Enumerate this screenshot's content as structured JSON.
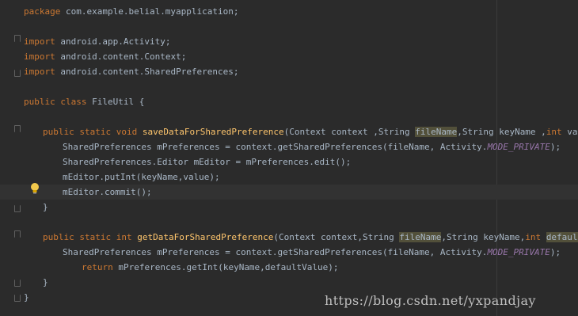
{
  "code": {
    "pkg_kw": "package",
    "pkg_name": " com.example.belial.myapplication;",
    "import_kw": "import",
    "import_1": " android.app.Activity;",
    "import_2": " android.content.Context;",
    "import_3": " android.content.SharedPreferences;",
    "class_kw": "public class",
    "class_name": " FileUtil {",
    "m1_kw": "public static void",
    "m1_name": "saveDataForSharedPreference",
    "m1_params_a": "(Context context ,String ",
    "m1_param_hl": "fileName",
    "m1_params_b": ",String keyName ,",
    "m1_int": "int",
    "m1_params_c": " value){",
    "m1_l1_a": "SharedPreferences mPreferences = context.getSharedPreferences(fileName, Activity.",
    "m1_l1_const": "MODE_PRIVATE",
    "m1_l1_b": ");",
    "m1_l2": "SharedPreferences.Editor mEditor = mPreferences.edit();",
    "m1_l3": "mEditor.putInt(keyName,value);",
    "m1_l4": "mEditor.commit();",
    "close_brace": "}",
    "m2_kw": "public static int",
    "m2_name": "getDataForSharedPreference",
    "m2_params_a": "(Context context,String ",
    "m2_param_hl1": "fileName",
    "m2_params_b": ",String keyName,",
    "m2_int": "int",
    "m2_param_hl2": "defaultValue",
    "m2_params_c": "){",
    "m2_l1_a": "SharedPreferences mPreferences = context.getSharedPreferences(fileName, Activity.",
    "m2_l1_const": "MODE_PRIVATE",
    "m2_l1_b": ");",
    "m2_return_kw": "return",
    "m2_return_rest": " mPreferences.getInt(keyName,defaultValue);"
  },
  "watermark": "https://blog.csdn.net/yxpandjay",
  "icons": {
    "intention": "lightbulb-icon",
    "fold": "fold-marker-icon"
  },
  "colors": {
    "background": "#2b2b2b",
    "keyword": "#cc7832",
    "method": "#ffc66d",
    "constant": "#9876aa",
    "text": "#a9b7c6"
  }
}
